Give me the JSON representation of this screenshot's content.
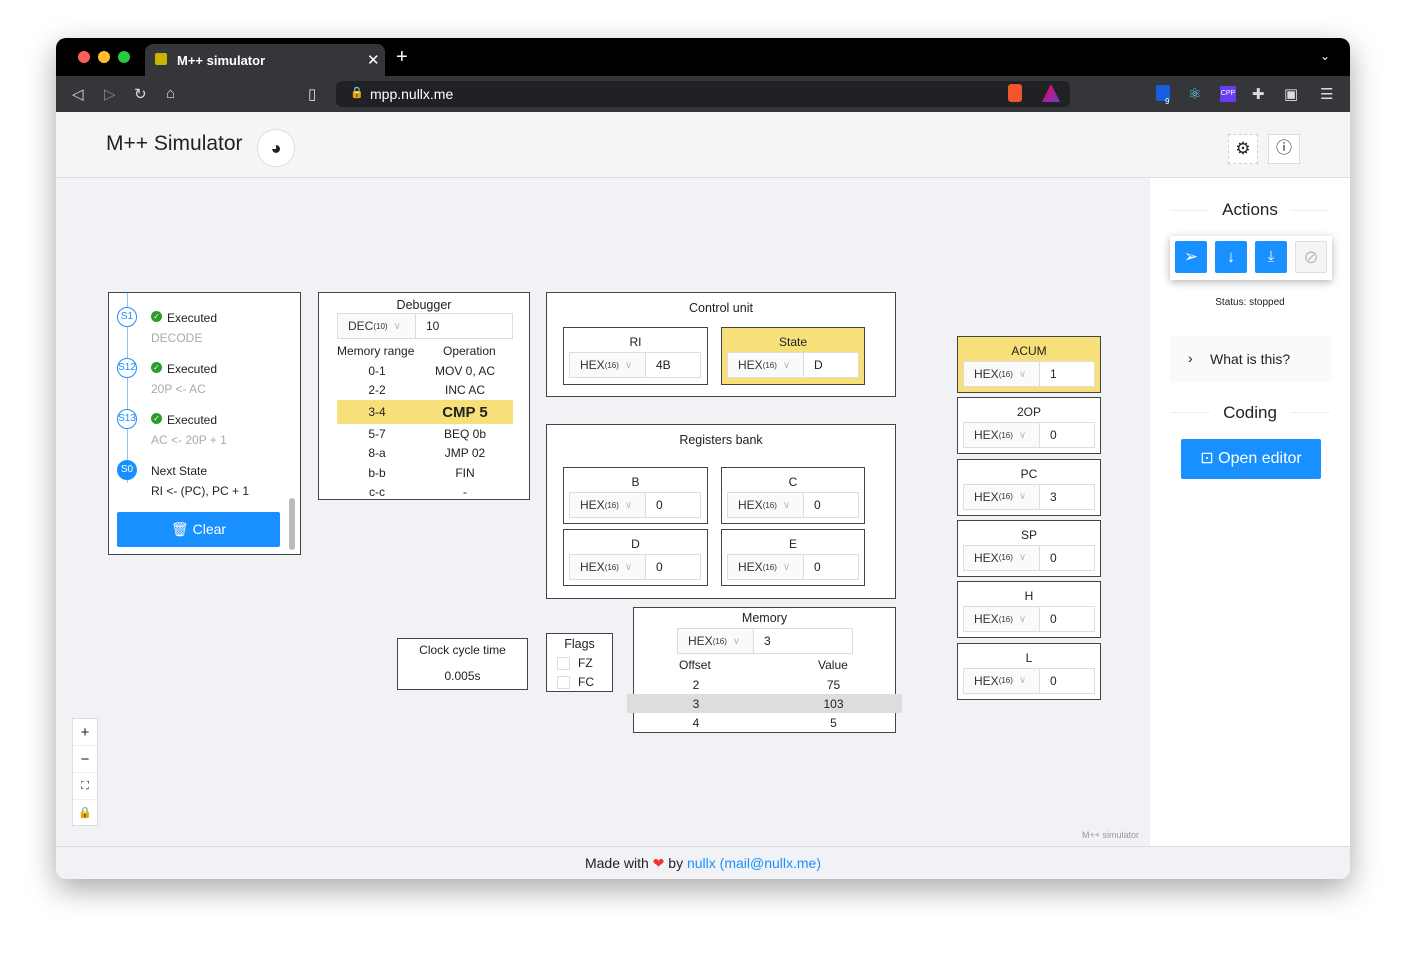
{
  "browser": {
    "tab_title": "M++ simulator",
    "url": "mpp.nullx.me",
    "ext_badge": "9"
  },
  "app": {
    "title": "M++ Simulator",
    "watermark": "M++ simulator"
  },
  "steps": [
    {
      "id": "S1",
      "status": "Executed",
      "desc": "DECODE"
    },
    {
      "id": "S12",
      "status": "Executed",
      "desc": "20P <- AC"
    },
    {
      "id": "S13",
      "status": "Executed",
      "desc": "AC <- 20P + 1"
    },
    {
      "id": "S0",
      "status": "Next State",
      "desc": "RI <- (PC), PC + 1"
    }
  ],
  "clear_label": "Clear",
  "debugger": {
    "title": "Debugger",
    "format": "DEC",
    "base": "(10)",
    "value": "10",
    "col_range": "Memory range",
    "col_op": "Operation",
    "rows": [
      [
        "0-1",
        "MOV 0, AC"
      ],
      [
        "2-2",
        "INC AC"
      ],
      [
        "3-4",
        "CMP 5"
      ],
      [
        "5-7",
        "BEQ 0b"
      ],
      [
        "8-a",
        "JMP 02"
      ],
      [
        "b-b",
        "FIN"
      ],
      [
        "c-c",
        "-"
      ]
    ],
    "highlight": "3-4"
  },
  "control_unit": {
    "title": "Control unit",
    "ri": {
      "label": "RI",
      "format": "HEX",
      "base": "(16)",
      "value": "4B"
    },
    "state": {
      "label": "State",
      "format": "HEX",
      "base": "(16)",
      "value": "D"
    }
  },
  "registers_bank": {
    "title": "Registers bank",
    "regs": [
      {
        "label": "B",
        "format": "HEX",
        "base": "(16)",
        "value": "0"
      },
      {
        "label": "C",
        "format": "HEX",
        "base": "(16)",
        "value": "0"
      },
      {
        "label": "D",
        "format": "HEX",
        "base": "(16)",
        "value": "0"
      },
      {
        "label": "E",
        "format": "HEX",
        "base": "(16)",
        "value": "0"
      }
    ]
  },
  "clock": {
    "title": "Clock cycle time",
    "value": "0.005s"
  },
  "flags": {
    "title": "Flags",
    "items": [
      {
        "label": "FZ",
        "checked": false
      },
      {
        "label": "FC",
        "checked": false
      }
    ]
  },
  "memory": {
    "title": "Memory",
    "format": "HEX",
    "base": "(16)",
    "value": "3",
    "col_offset": "Offset",
    "col_value": "Value",
    "rows": [
      [
        "2",
        "75"
      ],
      [
        "3",
        "103"
      ],
      [
        "4",
        "5"
      ]
    ],
    "highlight": "3"
  },
  "registers": [
    {
      "label": "ACUM",
      "format": "HEX",
      "base": "(16)",
      "value": "1",
      "highlight": true
    },
    {
      "label": "2OP",
      "format": "HEX",
      "base": "(16)",
      "value": "0"
    },
    {
      "label": "PC",
      "format": "HEX",
      "base": "(16)",
      "value": "3"
    },
    {
      "label": "SP",
      "format": "HEX",
      "base": "(16)",
      "value": "0"
    },
    {
      "label": "H",
      "format": "HEX",
      "base": "(16)",
      "value": "0"
    },
    {
      "label": "L",
      "format": "HEX",
      "base": "(16)",
      "value": "0"
    }
  ],
  "sidebar": {
    "actions_title": "Actions",
    "status": "Status: stopped",
    "what_is_this": "What is this?",
    "coding_title": "Coding",
    "open_editor": "Open editor"
  },
  "footer": {
    "made_with": "Made with",
    "by": "by",
    "author": "nullx",
    "email": "(mail@nullx.me)"
  },
  "colors": {
    "accent": "#1890ff",
    "highlight": "#f7e07a",
    "success": "#2a9d2a"
  }
}
